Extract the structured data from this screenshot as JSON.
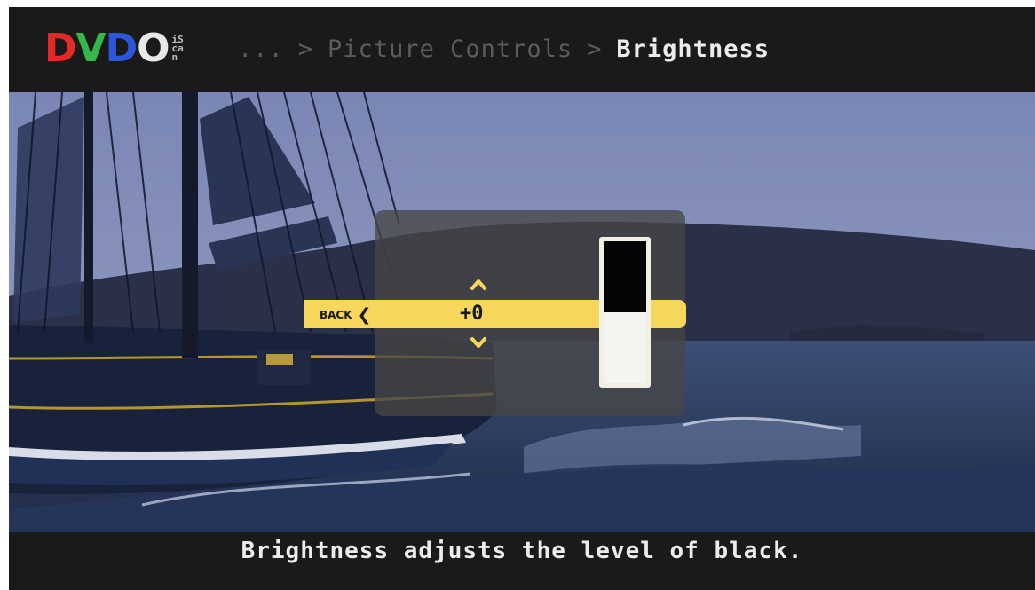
{
  "header": {
    "logo": {
      "letters": [
        "D",
        "V",
        "D",
        "O"
      ],
      "letter_colors": [
        "#e22a2a",
        "#34b84a",
        "#2d56d8",
        "#e8e8e8"
      ],
      "sub_text": "iScan"
    },
    "breadcrumb": {
      "ellipsis": "...",
      "separator": ">",
      "parent": "Picture Controls",
      "current": "Brightness"
    }
  },
  "control": {
    "back_label": "BACK",
    "back_icon": "chevron-left-icon",
    "value": "+0",
    "increase_icon": "chevron-up-icon",
    "decrease_icon": "chevron-down-icon",
    "level_black_fraction": 0.5,
    "accent_color": "#f6d65b"
  },
  "footer": {
    "caption": "Brightness adjusts the level of black."
  }
}
